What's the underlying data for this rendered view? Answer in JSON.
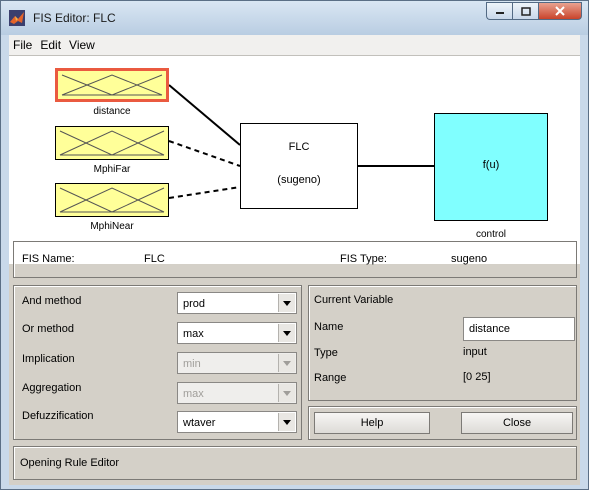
{
  "window": {
    "title": "FIS Editor: FLC"
  },
  "menu": [
    "File",
    "Edit",
    "View"
  ],
  "inputs": [
    {
      "name": "distance",
      "selected": true
    },
    {
      "name": "MphiFar",
      "selected": false
    },
    {
      "name": "MphiNear",
      "selected": false
    }
  ],
  "system": {
    "name": "FLC",
    "type_label": "(sugeno)"
  },
  "output": {
    "function": "f(u)",
    "name": "control"
  },
  "fis_info": {
    "name_label": "FIS Name:",
    "name_value": "FLC",
    "type_label": "FIS Type:",
    "type_value": "sugeno"
  },
  "methods": {
    "and": {
      "label": "And method",
      "value": "prod"
    },
    "or": {
      "label": "Or method",
      "value": "max"
    },
    "implication": {
      "label": "Implication",
      "value": "min"
    },
    "aggregation": {
      "label": "Aggregation",
      "value": "max"
    },
    "defuzz": {
      "label": "Defuzzification",
      "value": "wtaver"
    }
  },
  "current_variable": {
    "header": "Current Variable",
    "name_label": "Name",
    "name_value": "distance",
    "type_label": "Type",
    "type_value": "input",
    "range_label": "Range",
    "range_value": "[0 25]"
  },
  "buttons": {
    "help": "Help",
    "close": "Close"
  },
  "status": "Opening Rule Editor",
  "colors": {
    "input_box": "#ffff99",
    "selected_border": "#ea5a40",
    "output_box": "#80ffff",
    "panel": "#d4d0c8"
  }
}
